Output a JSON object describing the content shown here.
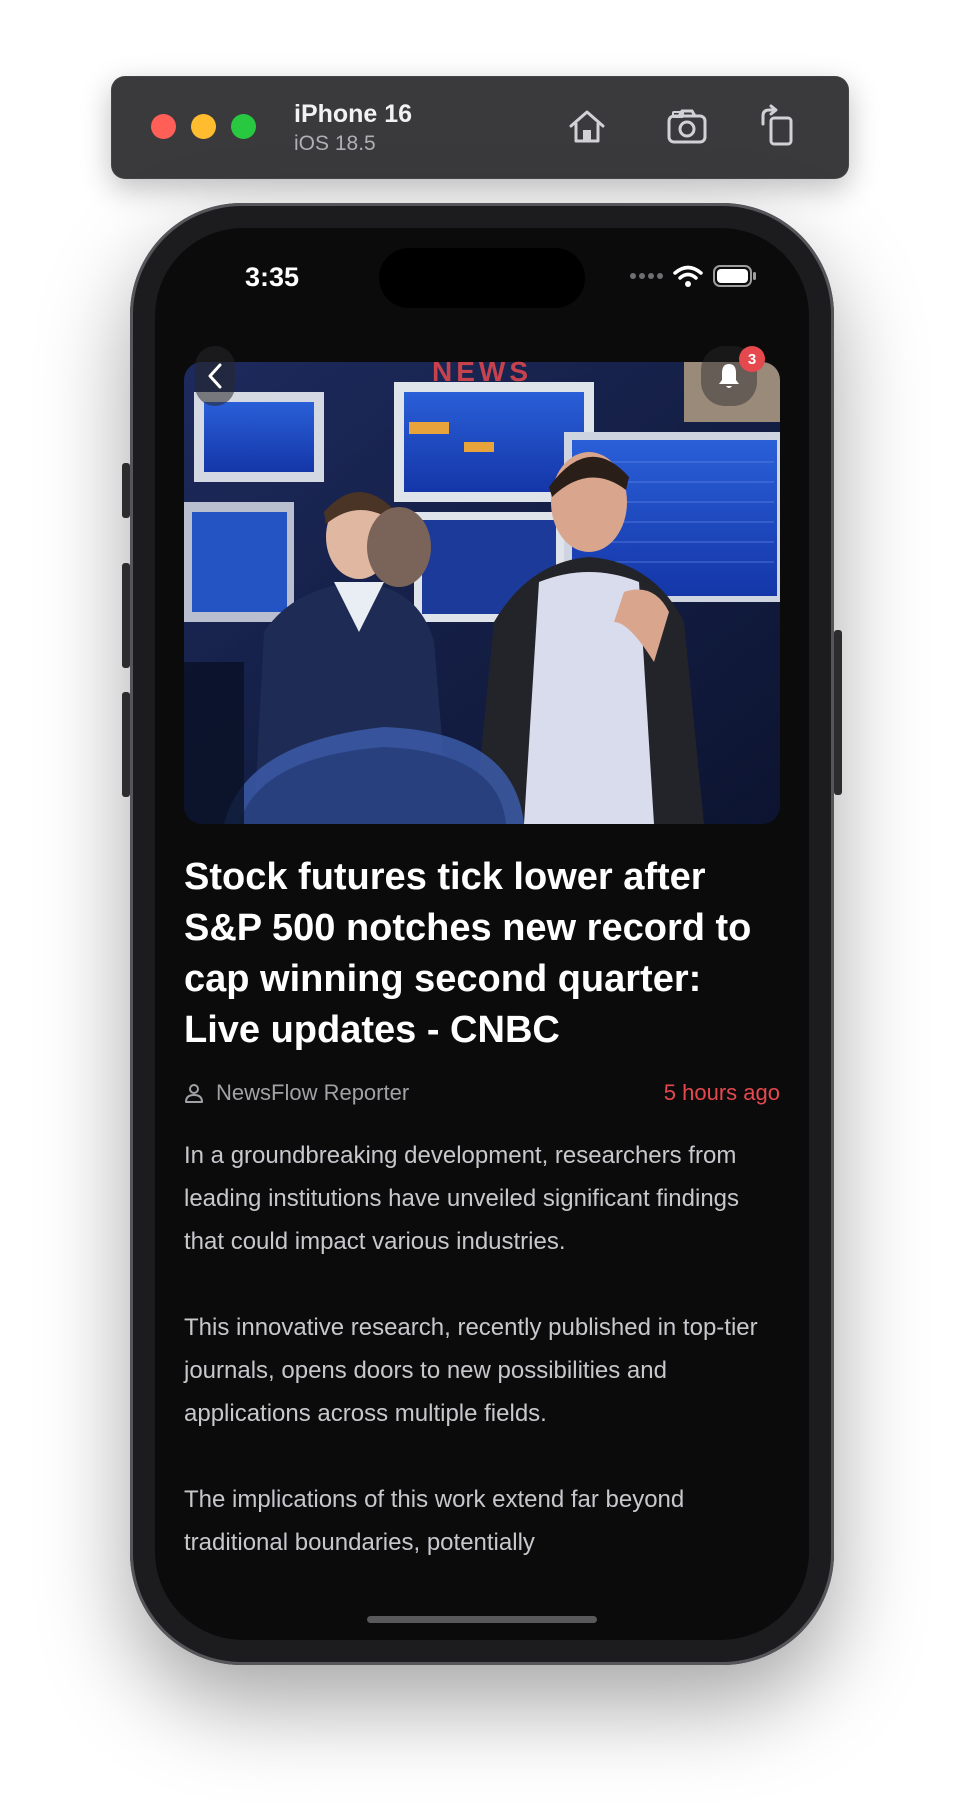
{
  "device": {
    "name": "iPhone 16",
    "os": "iOS 18.5"
  },
  "toolbar_icons": [
    "home-icon",
    "screenshot-icon",
    "rotate-icon"
  ],
  "status_bar": {
    "time": "3:35"
  },
  "app": {
    "brand": "NEWS",
    "notification_count": "3"
  },
  "article": {
    "image": "trading-floor-photo",
    "title": "Stock futures tick lower after S&P 500 notches new record to cap winning second quarter: Live updates - CNBC",
    "author": "NewsFlow Reporter",
    "published": "5 hours ago",
    "paragraphs": [
      "In a groundbreaking development, researchers from leading institutions have unveiled significant findings that could impact various industries.",
      "This innovative research, recently published in top-tier journals, opens doors to new possibilities and applications across multiple fields.",
      "The implications of this work extend far beyond traditional boundaries, potentially"
    ]
  },
  "colors": {
    "accent": "#e5484d",
    "background": "#0b0b0c",
    "text": "#ffffff"
  }
}
